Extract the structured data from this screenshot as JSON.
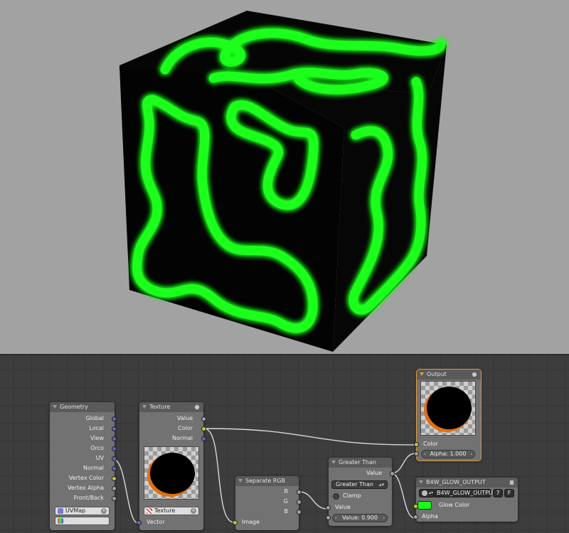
{
  "colors": {
    "viewport_bg": "#a2a2a2",
    "glow": "#1aff1a",
    "editor_bg": "#3d3d3d",
    "node_body": "#727272",
    "node_header": "#5a5a5a",
    "socket_vector": "#6363c7",
    "socket_value": "#a1a1a1",
    "socket_color": "#c7c729",
    "active_outline": "#e69d33",
    "link": "#d8d8d8"
  },
  "nodes": {
    "geometry": {
      "title": "Geometry",
      "outputs": [
        "Global",
        "Local",
        "View",
        "Orco",
        "UV",
        "Normal",
        "Vertex Color",
        "Vertex Alpha",
        "Front/Back"
      ],
      "uv_map": "UVMap",
      "uv_icon": "uv-map-icon",
      "vcol_icon": "vertex-color-icon"
    },
    "texture": {
      "title": "Texture",
      "outputs": [
        "Value",
        "Color",
        "Normal"
      ],
      "texture_name": "Texture",
      "input": "Vector"
    },
    "separate_rgb": {
      "title": "Separate RGB",
      "outputs": [
        "R",
        "G",
        "B"
      ],
      "input": "Image"
    },
    "greater_than": {
      "title": "Greater Than",
      "output": "Value",
      "operation": "Greater Than",
      "clamp_label": "Clamp",
      "input": "Value",
      "value_label": "Value:",
      "value": "0.900"
    },
    "output": {
      "title": "Output",
      "input": "Color",
      "alpha_label": "Alpha:",
      "alpha_value": "1.000"
    },
    "b4w_glow": {
      "title": "B4W_GLOW_OUTPUT",
      "group_name": "B4W_GLOW_OUTPUT",
      "users": "7",
      "fake_user": "F",
      "glow_color_label": "Glow Color",
      "glow_color": "#1aff1a",
      "alpha_label": "Alpha"
    }
  }
}
